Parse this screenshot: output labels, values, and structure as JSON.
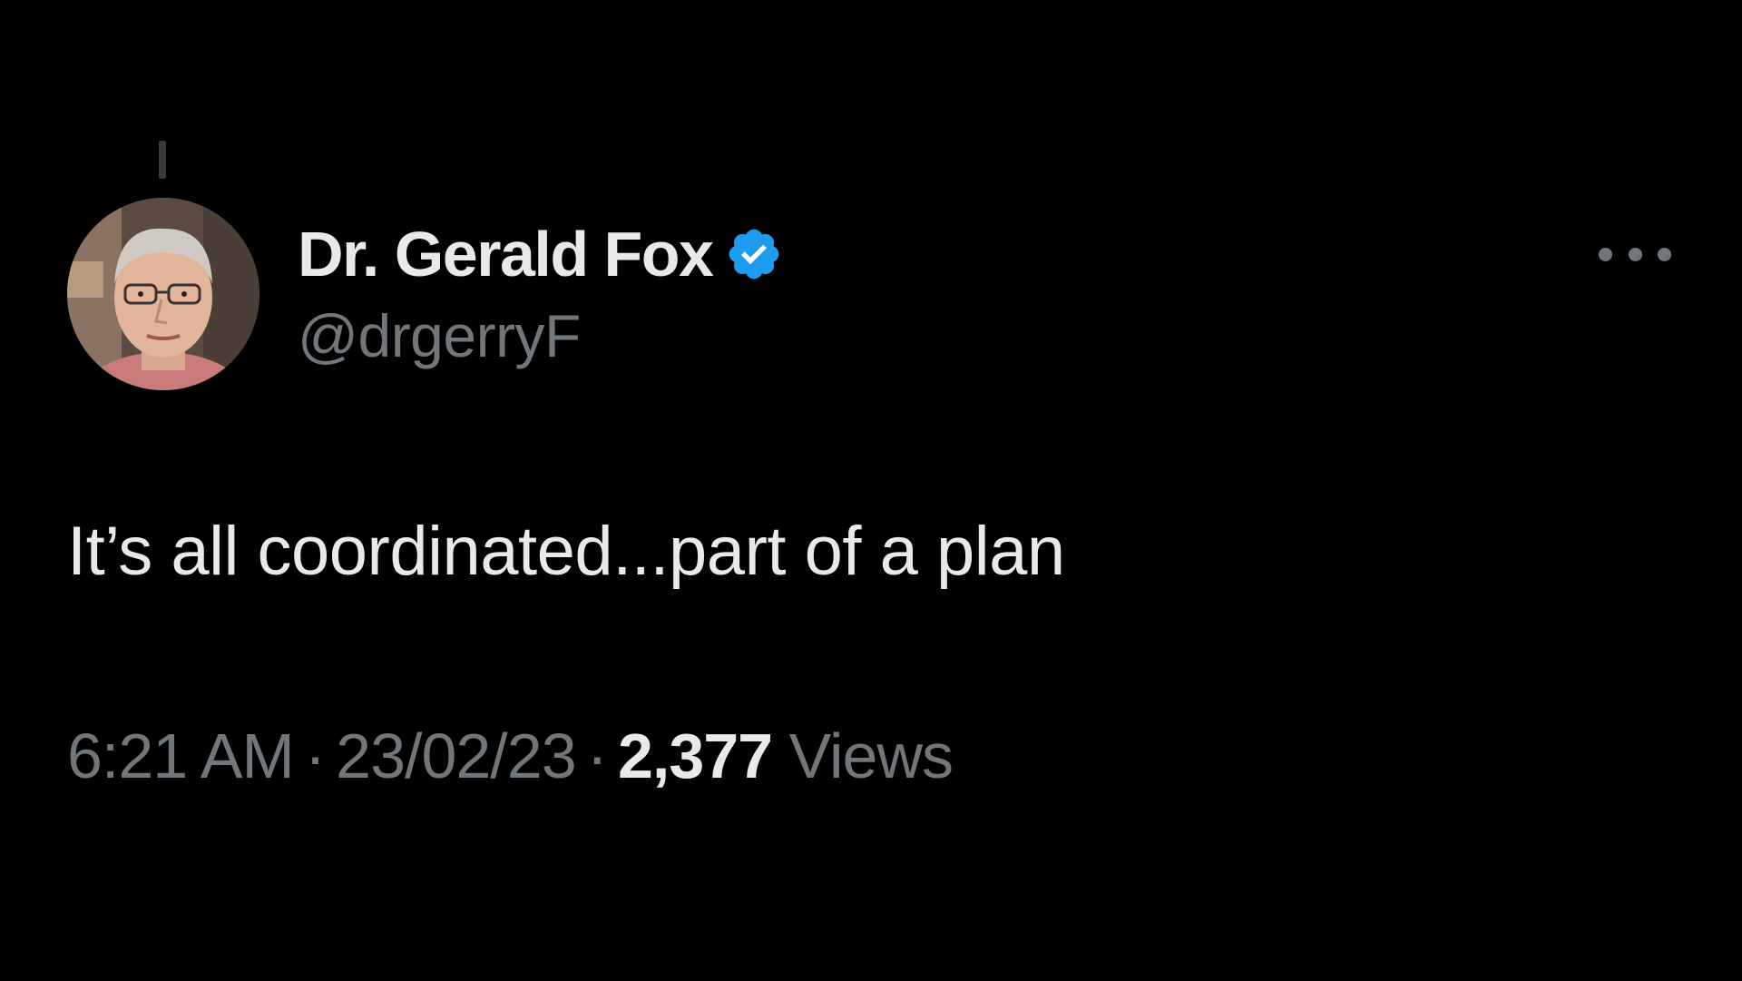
{
  "tweet": {
    "author": {
      "display_name": "Dr. Gerald Fox",
      "handle": "@drgerryF",
      "verified": true,
      "avatar_icon": "profile-photo"
    },
    "more_icon": "more-horizontal-icon",
    "text": "It’s all coordinated...part of a plan",
    "time": "6:21 AM",
    "separator": "·",
    "date": "23/02/23",
    "views_count": "2,377",
    "views_label": "Views"
  },
  "colors": {
    "background": "#000000",
    "primary_text": "#e7e9ea",
    "secondary_text": "#71767b",
    "verified_badge": "#1d9bf0"
  }
}
